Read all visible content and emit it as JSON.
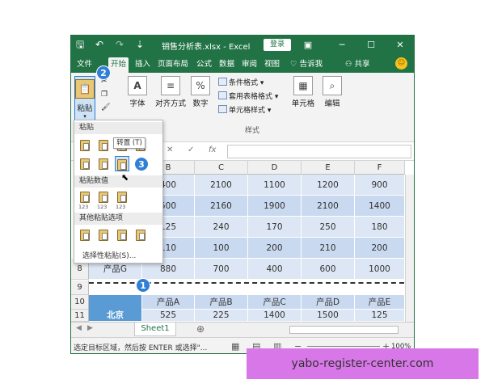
{
  "window": {
    "title": "销售分析表.xlsx - Excel",
    "login_label": "登录",
    "ribbon_display_icon": "ribbon-display-icon",
    "minimize": "─",
    "restore": "☐",
    "close": "✕"
  },
  "quick_access": {
    "save": "🖫",
    "undo": "↶",
    "redo": "↷",
    "customize": "⇣"
  },
  "tabs": [
    {
      "label": "文件"
    },
    {
      "label": "开始"
    },
    {
      "label": "插入"
    },
    {
      "label": "页面布局"
    },
    {
      "label": "公式"
    },
    {
      "label": "数据"
    },
    {
      "label": "审阅"
    },
    {
      "label": "视图"
    },
    {
      "label": "告诉我"
    },
    {
      "label": "共享"
    }
  ],
  "ribbon": {
    "paste_label": "粘贴",
    "font_label": "字体",
    "align_label": "对齐方式",
    "number_label": "数字",
    "cond_format": "条件格式 ▾",
    "table_format": "套用表格格式 ▾",
    "cell_style": "单元格样式 ▾",
    "styles_group": "样式",
    "cells_label": "单元格",
    "edit_label": "编辑"
  },
  "paste_menu": {
    "section_paste": "粘贴",
    "section_values": "粘贴数值",
    "section_other": "其他粘贴选项",
    "tooltip": "转置 (T)",
    "special": "选择性粘贴(S)...",
    "values_sub": "123"
  },
  "formula_bar": {
    "cancel": "✕",
    "enter": "✓",
    "fx": "fx"
  },
  "columns": [
    "B",
    "C",
    "D",
    "E",
    "F"
  ],
  "rows": [
    {
      "num": "",
      "cells": [
        "400",
        "2100",
        "1100",
        "1200",
        "900"
      ]
    },
    {
      "num": "",
      "cells": [
        "500",
        "2160",
        "1900",
        "2100",
        "1400"
      ]
    },
    {
      "num": "",
      "cells": [
        "125",
        "240",
        "170",
        "250",
        "180"
      ]
    },
    {
      "num": "",
      "cells": [
        "110",
        "100",
        "200",
        "210",
        "200"
      ]
    },
    {
      "num": "8",
      "label": "产品G",
      "cells": [
        "880",
        "700",
        "400",
        "600",
        "1000"
      ]
    },
    {
      "num": "9",
      "cells": [
        "",
        "",
        "",
        "",
        ""
      ]
    },
    {
      "num": "10",
      "label": "",
      "cells": [
        "产品A",
        "产品B",
        "产品C",
        "产品D",
        "产品E"
      ]
    },
    {
      "num": "11",
      "label": "北京",
      "cells": [
        "525",
        "225",
        "1400",
        "1500",
        "125"
      ]
    }
  ],
  "sheet": {
    "tab": "Sheet1",
    "add": "⊕"
  },
  "status": {
    "text": "选定目标区域，然后按 ENTER 或选择\"...",
    "zoom": "100%"
  },
  "badges": [
    "1",
    "2",
    "3"
  ],
  "watermark": "yabo-register-center.com"
}
